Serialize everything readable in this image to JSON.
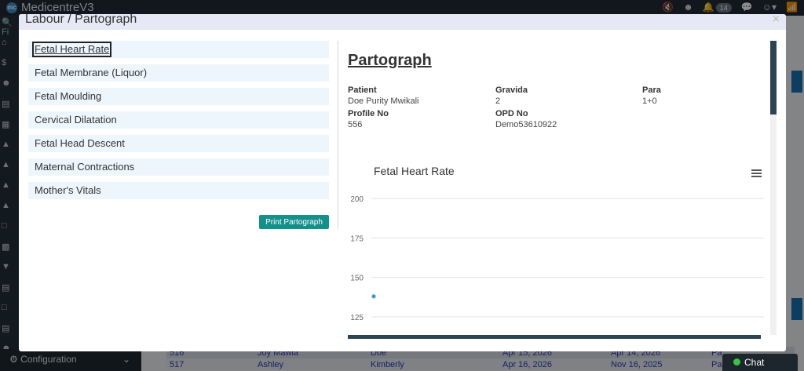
{
  "app": {
    "name": "MedicentreV3",
    "notification_count": "14"
  },
  "sidebar": {
    "search_placeholder": "Fi",
    "config_label": "Configuration"
  },
  "background_table": {
    "rows": [
      {
        "id": "516",
        "first": "Joy Mawia",
        "last": "Doe",
        "date1": "Apr 15, 2026",
        "date2": "Apr 14, 2026",
        "extra": "Pa"
      },
      {
        "id": "517",
        "first": "Ashley",
        "last": "Kimberly",
        "date1": "Apr 16, 2026",
        "date2": "Nov 16, 2025",
        "extra": "Pa"
      }
    ]
  },
  "chat": {
    "label": "Chat"
  },
  "modal": {
    "title": "Labour / Partograph",
    "close": "×",
    "nav_items": [
      "Fetal Heart Rate",
      "Fetal Membrane (Liquor)",
      "Fetal Moulding",
      "Cervical Dilatation",
      "Fetal Head Descent",
      "Maternal Contractions",
      "Mother's Vitals"
    ],
    "print_button": "Print Partograph",
    "document": {
      "title": "Partograph",
      "patient_label": "Patient",
      "patient_value": "Doe Purity Mwikali",
      "gravida_label": "Gravida",
      "gravida_value": "2",
      "para_label": "Para",
      "para_value": "1+0",
      "profile_label": "Profile No",
      "profile_value": "556",
      "opd_label": "OPD No",
      "opd_value": "Demo53610922"
    }
  },
  "chart_data": {
    "type": "scatter",
    "title": "Fetal Heart Rate",
    "xlabel": "",
    "ylabel": "",
    "ylim": [
      125,
      200
    ],
    "yticks": [
      200,
      175,
      150,
      125
    ],
    "grid": true,
    "series": [
      {
        "x": [
          0
        ],
        "y": [
          138
        ]
      }
    ],
    "color": "#3d8fc7"
  }
}
